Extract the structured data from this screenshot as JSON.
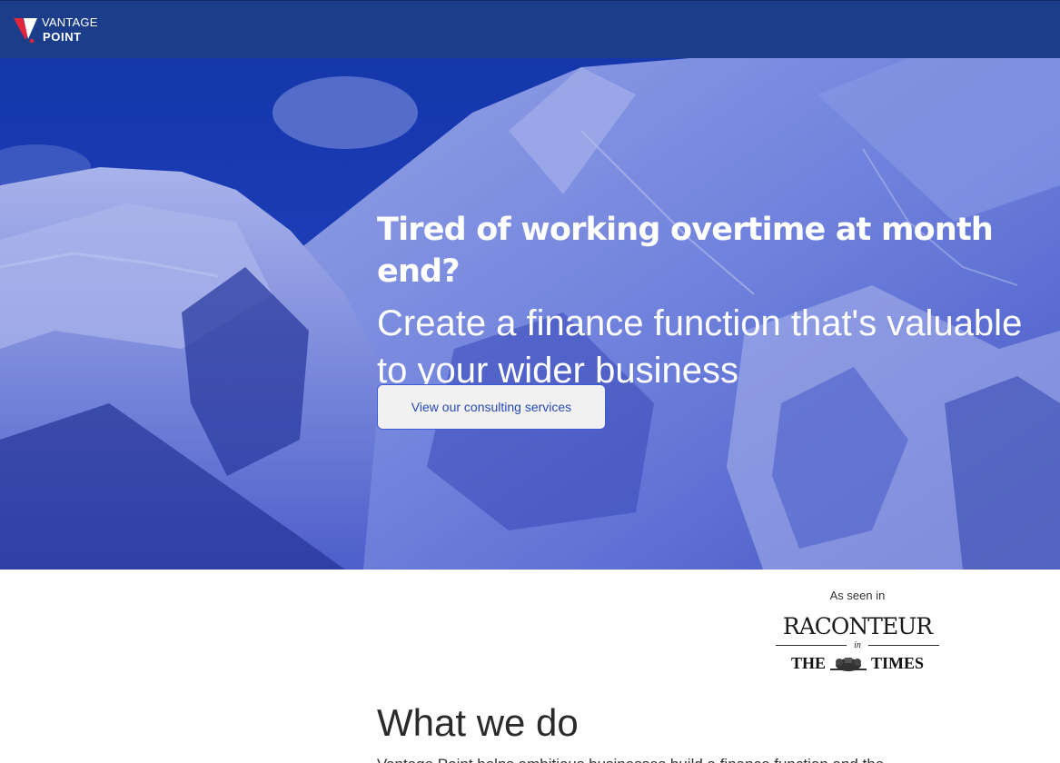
{
  "brand": {
    "name_line1": "VANTAGE",
    "name_line2": "POINT",
    "primary_color": "#1c3e8a",
    "accent_color": "#e0263d"
  },
  "hero": {
    "headline": "Tired of working overtime at month end?",
    "subheadline": "Create a finance function that's valuable to your wider business",
    "cta_label": "View our consulting services",
    "background": "snowy-mountain-photo-blue-overlay"
  },
  "press": {
    "label": "As seen in",
    "publication": "RACONTEUR",
    "connector": "in",
    "newspaper_left": "THE",
    "newspaper_right": "TIMES"
  },
  "section": {
    "title": "What we do",
    "body_partial": "Vantage Point helps ambitious businesses build a finance function and the"
  }
}
